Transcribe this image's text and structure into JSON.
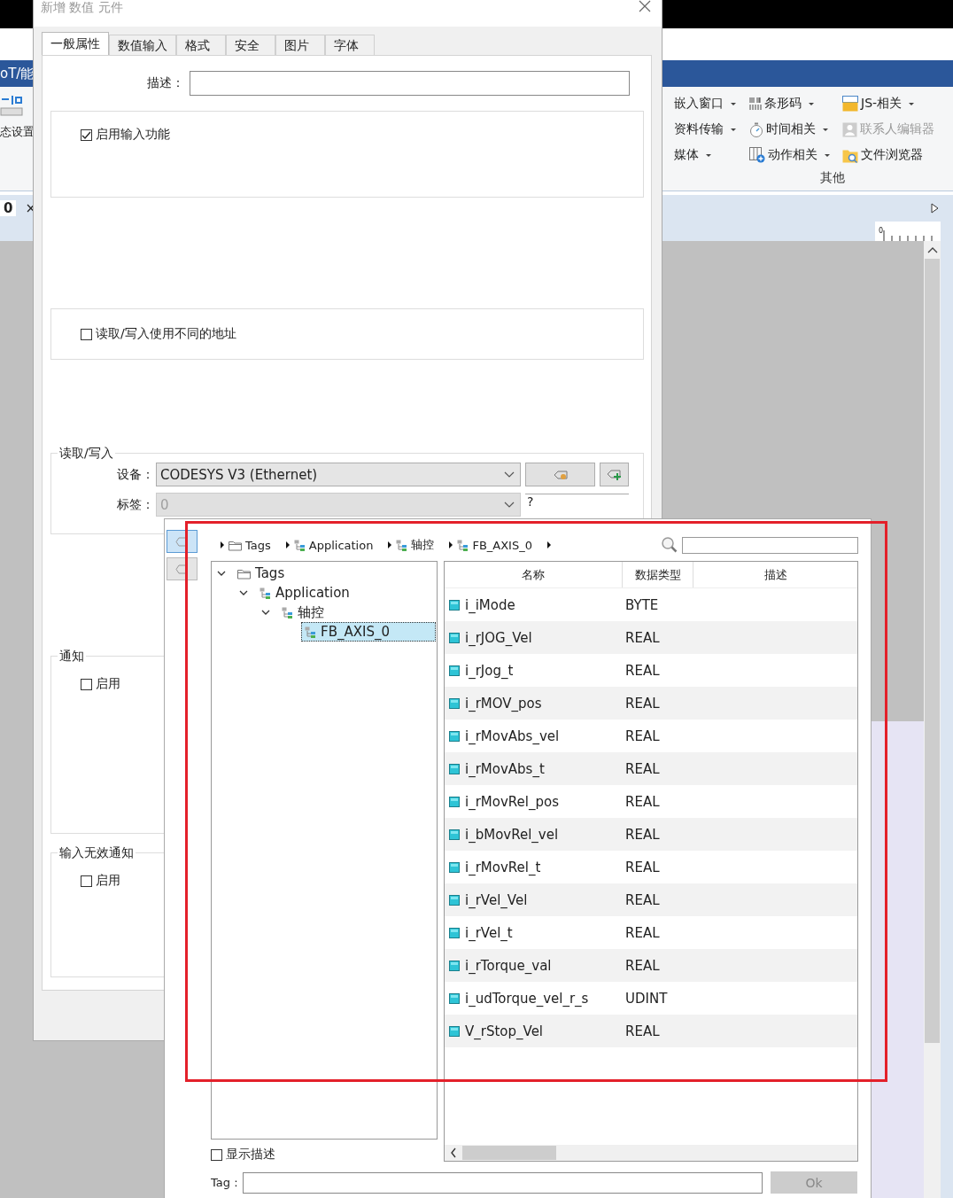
{
  "app": {
    "title_fragment": "oT/能",
    "tool_label": "态设置",
    "doc_tab": {
      "label": "0",
      "close": "×"
    },
    "ribbon": {
      "columns": [
        [
          {
            "label": "嵌入窗口",
            "dropdown": true,
            "disabled": false
          },
          {
            "label": "资料传输",
            "dropdown": true,
            "disabled": false
          },
          {
            "label": "媒体",
            "dropdown": true,
            "disabled": false
          }
        ],
        [
          {
            "label": "条形码",
            "dropdown": true,
            "disabled": false
          },
          {
            "label": "时间相关",
            "dropdown": true,
            "disabled": false
          },
          {
            "label": "动作相关",
            "dropdown": true,
            "disabled": false
          }
        ],
        [
          {
            "label": "JS-相关",
            "dropdown": true,
            "disabled": false
          },
          {
            "label": "联系人编辑器",
            "dropdown": false,
            "disabled": true
          },
          {
            "label": "文件浏览器",
            "dropdown": false,
            "disabled": false
          }
        ]
      ],
      "group_label": "其他"
    },
    "ruler_label": "0"
  },
  "dialog": {
    "title": "新增 数值 元件",
    "tabs": [
      {
        "label": "一般属性",
        "selected": true
      },
      {
        "label": "数值输入",
        "selected": false
      },
      {
        "label": "格式",
        "selected": false
      },
      {
        "label": "安全",
        "selected": false
      },
      {
        "label": "图片",
        "selected": false
      },
      {
        "label": "字体",
        "selected": false
      }
    ],
    "description_label": "描述：",
    "enable_input": {
      "label": "启用输入功能",
      "checked": true
    },
    "different_address": {
      "label": "读取/写入使用不同的地址",
      "checked": false
    },
    "read_write": {
      "title": "读取/写入",
      "device_label": "设备：",
      "device_value": "CODESYS V3 (Ethernet)",
      "tag_label": "标签：",
      "tag_value": "0",
      "tag_disabled": true,
      "address_value": "?"
    },
    "notification": {
      "title": "通知",
      "enable": {
        "label": "启用",
        "checked": false
      }
    },
    "invalid_notification": {
      "title": "输入无效通知",
      "enable": {
        "label": "启用",
        "checked": false
      }
    }
  },
  "tag_browser": {
    "side_buttons": [
      {
        "selected": true
      },
      {
        "selected": false
      }
    ],
    "breadcrumb": [
      {
        "label": "Tags",
        "kind": "folder"
      },
      {
        "label": "Application",
        "kind": "node"
      },
      {
        "label": "轴控",
        "kind": "node"
      },
      {
        "label": "FB_AXIS_0",
        "kind": "node"
      }
    ],
    "tree": [
      {
        "label": "Tags",
        "kind": "folder",
        "expanded": true,
        "selected": false,
        "children": [
          {
            "label": "Application",
            "kind": "node",
            "expanded": true,
            "selected": false,
            "children": [
              {
                "label": "轴控",
                "kind": "node",
                "expanded": true,
                "selected": false,
                "children": [
                  {
                    "label": "FB_AXIS_0",
                    "kind": "node",
                    "selected": true
                  }
                ]
              }
            ]
          }
        ]
      }
    ],
    "columns": [
      "名称",
      "数据类型",
      "描述"
    ],
    "rows": [
      {
        "name": "i_iMode",
        "type": "BYTE"
      },
      {
        "name": "i_rJOG_Vel",
        "type": "REAL"
      },
      {
        "name": "i_rJog_t",
        "type": "REAL"
      },
      {
        "name": "i_rMOV_pos",
        "type": "REAL"
      },
      {
        "name": "i_rMovAbs_vel",
        "type": "REAL"
      },
      {
        "name": "i_rMovAbs_t",
        "type": "REAL"
      },
      {
        "name": "i_rMovRel_pos",
        "type": "REAL"
      },
      {
        "name": "i_bMovRel_vel",
        "type": "REAL"
      },
      {
        "name": "i_rMovRel_t",
        "type": "REAL"
      },
      {
        "name": "i_rVel_Vel",
        "type": "REAL"
      },
      {
        "name": "i_rVel_t",
        "type": "REAL"
      },
      {
        "name": "i_rTorque_val",
        "type": "REAL"
      },
      {
        "name": "i_udTorque_vel_r_s",
        "type": "UDINT"
      },
      {
        "name": "V_rStop_Vel",
        "type": "REAL"
      }
    ],
    "show_description": {
      "label": "显示描述",
      "checked": false
    },
    "tag_label": "Tag :",
    "ok_button": {
      "label": "Ok",
      "disabled": true
    }
  }
}
